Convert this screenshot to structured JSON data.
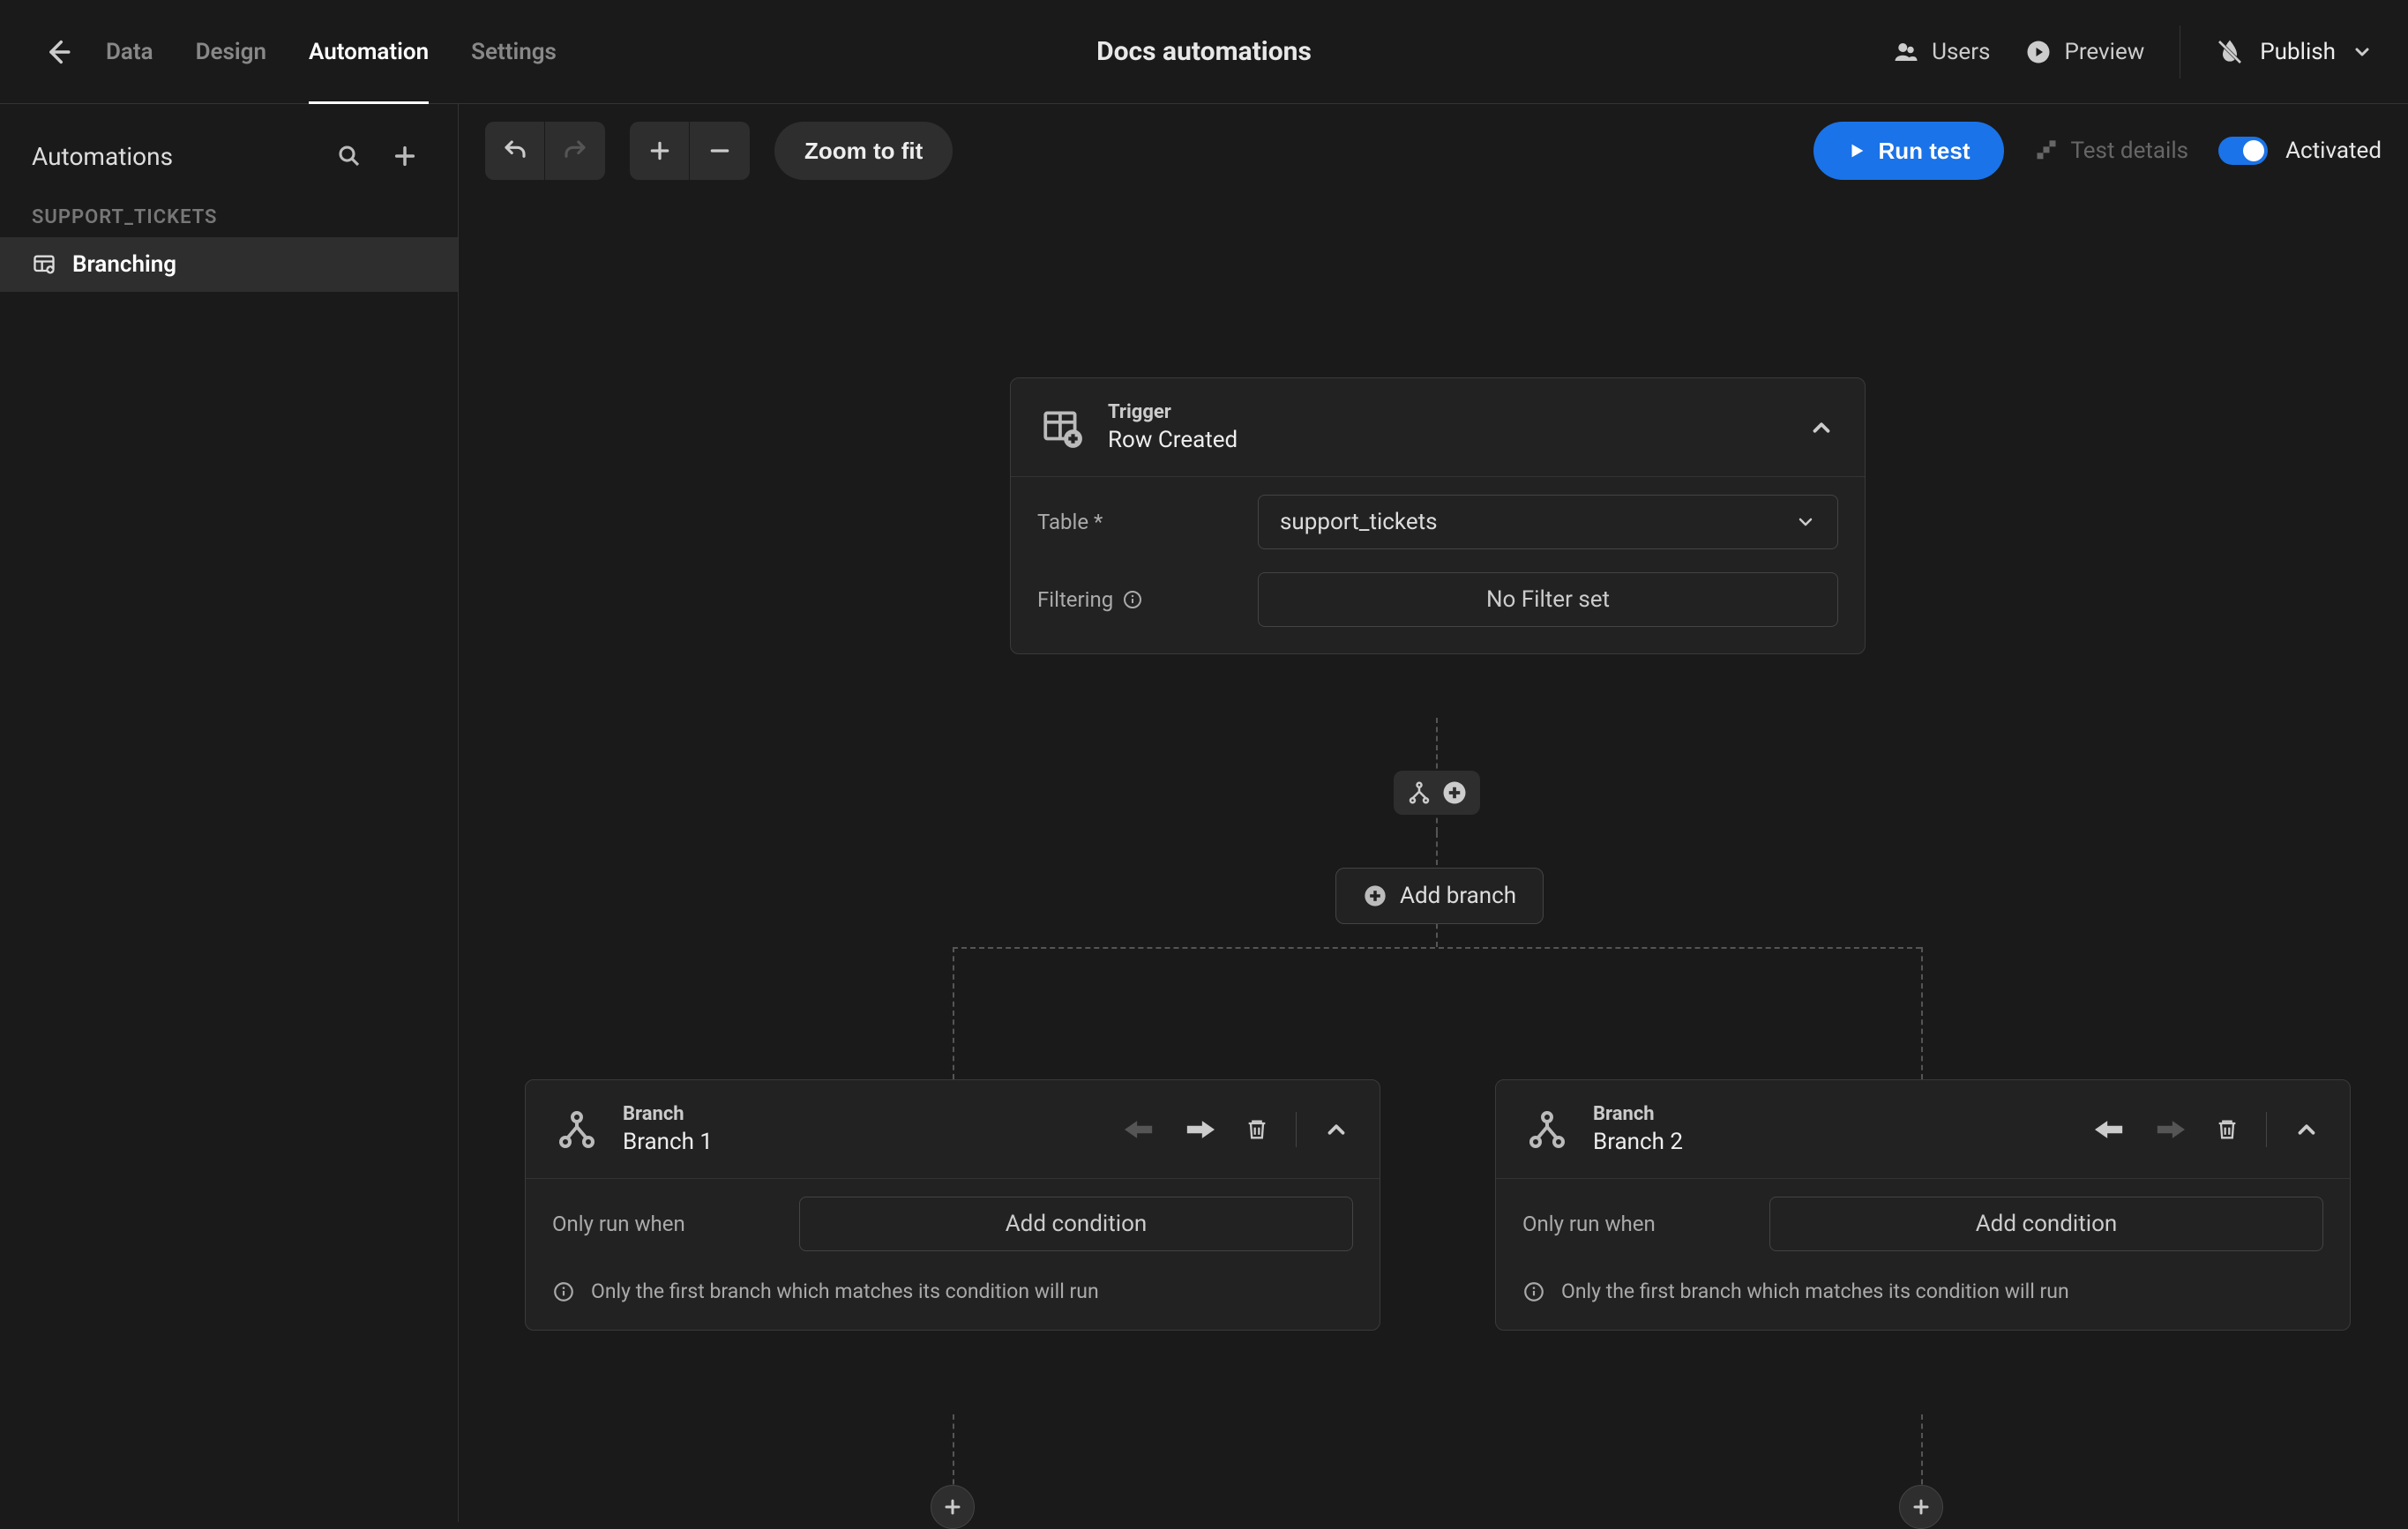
{
  "header": {
    "title": "Docs automations",
    "tabs": {
      "data": "Data",
      "design": "Design",
      "automation": "Automation",
      "settings": "Settings"
    },
    "users": "Users",
    "preview": "Preview",
    "publish": "Publish"
  },
  "sidebar": {
    "title": "Automations",
    "section": "SUPPORT_TICKETS",
    "item": "Branching"
  },
  "toolbar": {
    "zoom_fit": "Zoom to fit",
    "run_test": "Run test",
    "test_details": "Test details",
    "activated": "Activated"
  },
  "flow": {
    "trigger": {
      "kicker": "Trigger",
      "name": "Row Created",
      "table_label": "Table *",
      "table_value": "support_tickets",
      "filter_label": "Filtering",
      "filter_value": "No Filter set"
    },
    "add_branch": "Add branch",
    "branch1": {
      "kicker": "Branch",
      "name": "Branch 1",
      "run_when": "Only run when",
      "add_condition": "Add condition",
      "note": "Only the first branch which matches its condition will run"
    },
    "branch2": {
      "kicker": "Branch",
      "name": "Branch 2",
      "run_when": "Only run when",
      "add_condition": "Add condition",
      "note": "Only the first branch which matches its condition will run"
    }
  }
}
